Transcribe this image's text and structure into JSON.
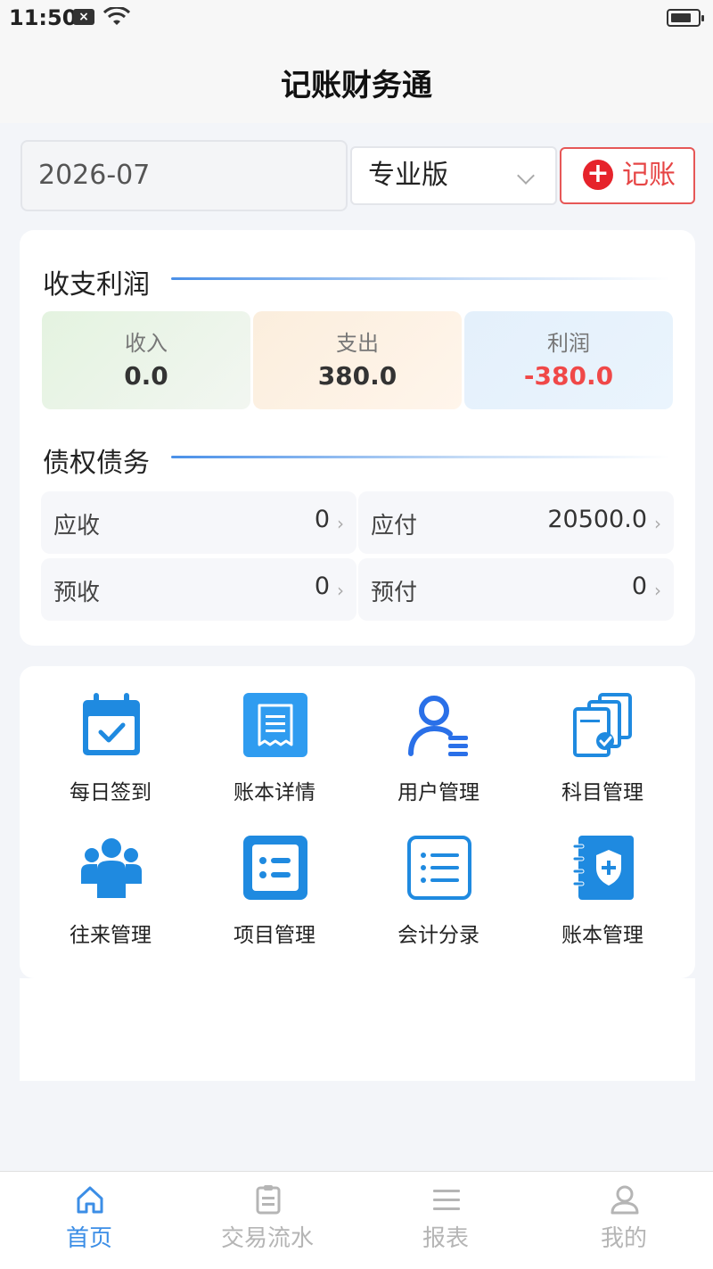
{
  "status_bar": {
    "time": "11:50"
  },
  "header": {
    "title": "记账财务通"
  },
  "toolbar": {
    "date": "2026-07",
    "edition": "专业版",
    "record_label": "记账"
  },
  "income_section": {
    "title": "收支利润",
    "stats": [
      {
        "label": "收入",
        "value": "0.0"
      },
      {
        "label": "支出",
        "value": "380.0"
      },
      {
        "label": "利润",
        "value": "-380.0"
      }
    ]
  },
  "debt_section": {
    "title": "债权债务",
    "items": [
      {
        "label": "应收",
        "value": "0"
      },
      {
        "label": "应付",
        "value": "20500.0"
      },
      {
        "label": "预收",
        "value": "0"
      },
      {
        "label": "预付",
        "value": "0"
      }
    ]
  },
  "menu": [
    {
      "label": "每日签到",
      "icon": "calendar-check-icon"
    },
    {
      "label": "账本详情",
      "icon": "receipt-icon"
    },
    {
      "label": "用户管理",
      "icon": "user-list-icon"
    },
    {
      "label": "科目管理",
      "icon": "documents-check-icon"
    },
    {
      "label": "往来管理",
      "icon": "group-icon"
    },
    {
      "label": "项目管理",
      "icon": "list-box-icon"
    },
    {
      "label": "会计分录",
      "icon": "ledger-list-icon"
    },
    {
      "label": "账本管理",
      "icon": "shield-notebook-icon"
    }
  ],
  "tabs": [
    {
      "label": "首页",
      "icon": "home-icon",
      "active": true
    },
    {
      "label": "交易流水",
      "icon": "clipboard-icon",
      "active": false
    },
    {
      "label": "报表",
      "icon": "menu-lines-icon",
      "active": false
    },
    {
      "label": "我的",
      "icon": "person-icon",
      "active": false
    }
  ],
  "colors": {
    "accent": "#3c8ee6",
    "icon_blue": "#1f8ae0",
    "record_red": "#e6232b",
    "profit_negative": "#f04848"
  }
}
